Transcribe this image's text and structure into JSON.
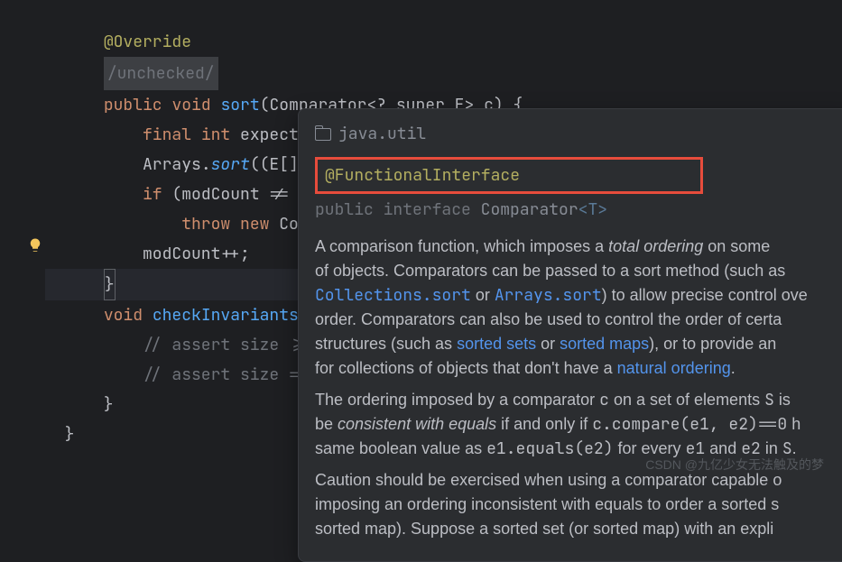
{
  "code": {
    "override": "@Override",
    "unchecked": "/unchecked/",
    "kw_public": "public",
    "kw_void": "void",
    "kw_final": "final",
    "kw_int": "int",
    "kw_if": "if",
    "kw_throw": "throw",
    "kw_new": "new",
    "method_sort": "sort",
    "type_comparator": "Comparator",
    "generic_part": "<? super E>",
    "param_c": " c) ",
    "expected": "expected",
    "arrays": "Arrays",
    "arrays_sort": "sort",
    "cast": "((E[]) ",
    "if_cond": "(modCount != ex",
    "conc": "Conc",
    "modcount": "modCount++;",
    "method_check": "checkInvariants()",
    "assert1": "// assert size >= ",
    "assert2": "// assert size == "
  },
  "tooltip": {
    "package": "java.util",
    "functional": "@FunctionalInterface",
    "decl_public": "public",
    "decl_interface": "interface",
    "decl_name": "Comparator",
    "decl_generic": "<T>",
    "body": {
      "p1_a": "A comparison function, which imposes a ",
      "p1_italic": "total ordering",
      "p1_b": " on some ",
      "p1_c": "of objects. Comparators can be passed to a sort method (such as",
      "link1": "Collections.sort",
      "or1": " or ",
      "link2": "Arrays.sort",
      "p1_d": ") to allow precise control ove",
      "p1_e": "order. Comparators can also be used to control the order of certa",
      "p1_f": "structures (such as ",
      "link3": "sorted sets",
      "or2": " or ",
      "link4": "sorted maps",
      "p1_g": "), or to provide an ",
      "p1_h": "for collections of objects that don't have a ",
      "link5": "natural ordering",
      "p1_i": ".",
      "p2_a": "The ordering imposed by a comparator ",
      "p2_mono1": "c",
      "p2_b": " on a set of elements ",
      "p2_mono2": "S",
      "p2_c": " is",
      "p2_d": "be ",
      "p2_italic": "consistent with equals",
      "p2_e": " if and only if ",
      "p2_mono3": "c.compare(e1, e2)==0",
      "p2_f": " h",
      "p2_g": "same boolean value as ",
      "p2_mono4": "e1.equals(e2)",
      "p2_h": " for every ",
      "p2_mono5": "e1",
      "p2_i": " and ",
      "p2_mono6": "e2",
      "p2_j": " in ",
      "p2_mono7": "S",
      "p2_k": ".",
      "p3_a": "Caution should be exercised when using a comparator capable o",
      "p3_b": "imposing an ordering inconsistent with equals to order a sorted s",
      "p3_c": "sorted map). Suppose a sorted set (or sorted map) with an expli"
    }
  },
  "watermark": "CSDN @九亿少女无法触及的梦"
}
